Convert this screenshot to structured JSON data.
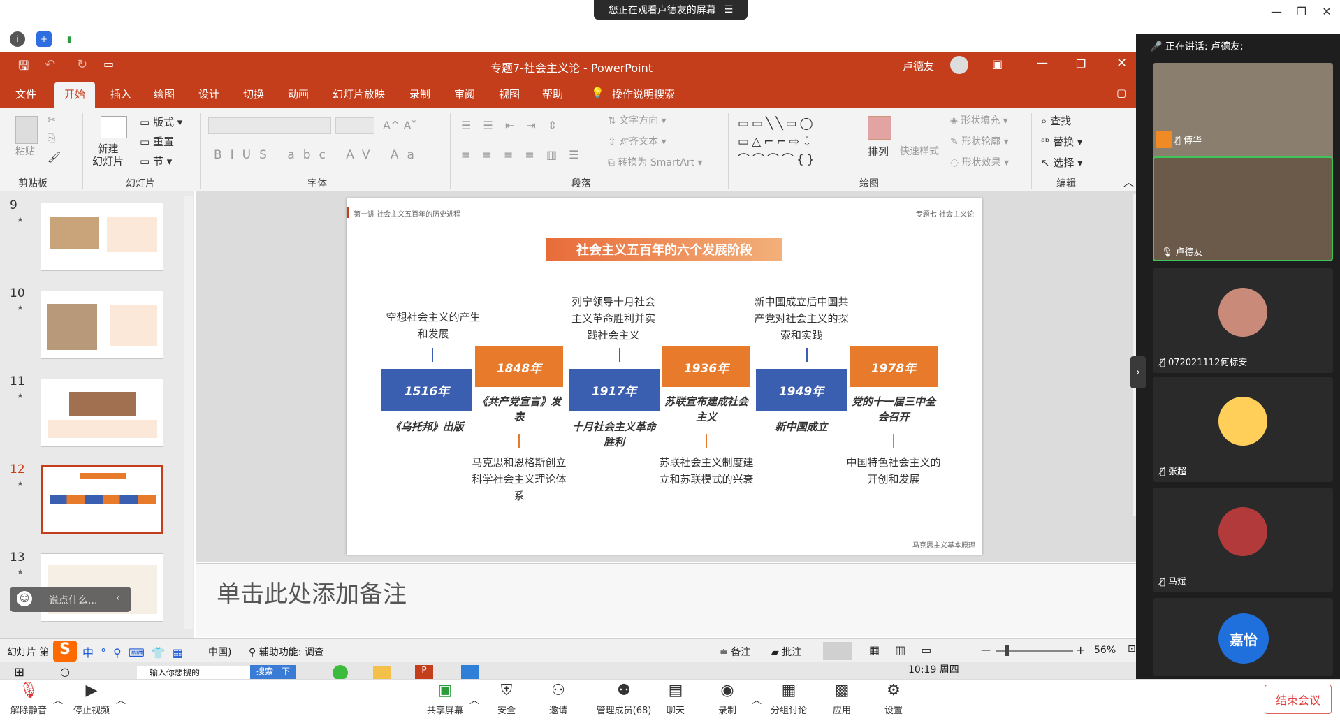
{
  "meeting": {
    "share_banner": "您正在观看卢德友的屏幕",
    "speaking": "正在讲话: 卢德友;",
    "end_button": "结束会议",
    "toolbar": [
      {
        "icon": "mic-muted-icon",
        "label": "解除静音"
      },
      {
        "icon": "camera-off-icon",
        "label": "停止视频"
      },
      {
        "icon": "share-screen-icon",
        "label": "共享屏幕"
      },
      {
        "icon": "shield-icon",
        "label": "安全"
      },
      {
        "icon": "invite-icon",
        "label": "邀请"
      },
      {
        "icon": "members-icon",
        "label": "管理成员(68)"
      },
      {
        "icon": "chat-icon",
        "label": "聊天"
      },
      {
        "icon": "record-icon",
        "label": "录制"
      },
      {
        "icon": "breakout-icon",
        "label": "分组讨论"
      },
      {
        "icon": "apps-icon",
        "label": "应用"
      },
      {
        "icon": "settings-icon",
        "label": "设置"
      }
    ],
    "participants": [
      {
        "name": "傅华",
        "muted": true
      },
      {
        "name": "卢德友",
        "muted": false,
        "active": true
      },
      {
        "name": "072021112何标安",
        "muted": true
      },
      {
        "name": "张超",
        "muted": true
      },
      {
        "name": "马斌",
        "muted": true
      },
      {
        "name": "嘉怡",
        "avatar_text": "嘉怡"
      }
    ]
  },
  "ppt": {
    "title": "专题7-社会主义论  -  PowerPoint",
    "user": "卢德友",
    "tabs": [
      "文件",
      "开始",
      "插入",
      "绘图",
      "设计",
      "切换",
      "动画",
      "幻灯片放映",
      "录制",
      "审阅",
      "视图",
      "帮助",
      "操作说明搜索"
    ],
    "active_tab": "开始",
    "ribbon": {
      "clipboard": {
        "paste": "粘贴",
        "group": "剪贴板"
      },
      "slides": {
        "new": "新建\n幻灯片",
        "layout": "版式",
        "reset": "重置",
        "section": "节",
        "group": "幻灯片"
      },
      "font_group": "字体",
      "paragraph": {
        "text_dir": "文字方向",
        "align_text": "对齐文本",
        "smartart": "转换为 SmartArt",
        "group": "段落"
      },
      "drawing": {
        "arrange": "排列",
        "quick_styles": "快速样式",
        "fill": "形状填充",
        "outline": "形状轮廓",
        "effects": "形状效果",
        "group": "绘图"
      },
      "editing": {
        "find": "查找",
        "replace": "替换",
        "select": "选择",
        "group": "编辑"
      }
    },
    "thumbnails": [
      {
        "num": "9"
      },
      {
        "num": "10"
      },
      {
        "num": "11"
      },
      {
        "num": "12",
        "selected": true
      },
      {
        "num": "13"
      }
    ],
    "chat_placeholder": "说点什么...",
    "notes_placeholder": "单击此处添加备注",
    "status": {
      "slide": "幻灯片 第",
      "lang": "中国)",
      "accessibility": "辅助功能: 调查",
      "notes": "备注",
      "comments": "批注",
      "zoom": "56%"
    },
    "taskbar": {
      "search": "输入你想搜的",
      "search_btn": "搜索一下",
      "time": "10:19 周四"
    }
  },
  "slide": {
    "header_left": "第一讲 社会主义五百年的历史进程",
    "header_right": "专题七 社会主义论",
    "title": "社会主义五百年的六个发展阶段",
    "footer": "马克思主义基本原理",
    "stages": [
      {
        "year": "1516年",
        "color": "blue",
        "event": "《乌托邦》出版",
        "caption": "空想社会主义的产生和发展"
      },
      {
        "year": "1848年",
        "color": "orange",
        "event": "《共产党宣言》发表",
        "caption": "马克思和恩格斯创立科学社会主义理论体系"
      },
      {
        "year": "1917年",
        "color": "blue",
        "event": "十月社会主义革命胜利",
        "caption": "列宁领导十月社会主义革命胜利并实践社会主义"
      },
      {
        "year": "1936年",
        "color": "orange",
        "event": "苏联宣布建成社会主义",
        "caption": "苏联社会主义制度建立和苏联模式的兴衰"
      },
      {
        "year": "1949年",
        "color": "blue",
        "event": "新中国成立",
        "caption": "新中国成立后中国共产党对社会主义的探索和实践"
      },
      {
        "year": "1978年",
        "color": "orange",
        "event": "党的十一届三中全会召开",
        "caption": "中国特色社会主义的开创和发展"
      }
    ]
  }
}
